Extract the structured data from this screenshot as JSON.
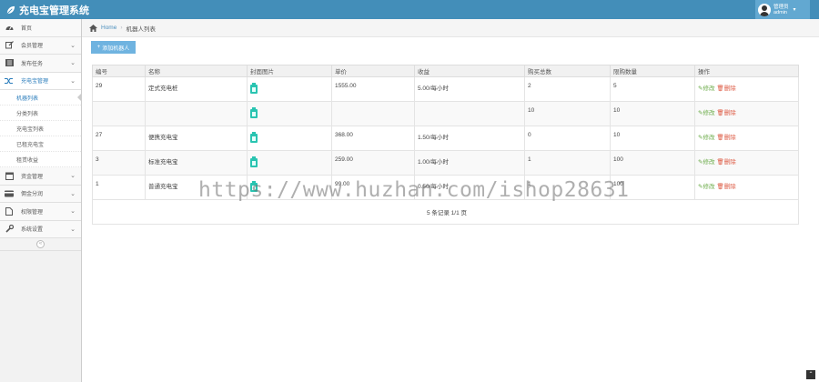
{
  "app": {
    "title": "充电宝管理系统"
  },
  "user": {
    "role": "管理员",
    "name": "admin"
  },
  "sidebar": {
    "items": [
      {
        "label": "首页",
        "icon": "tachometer-icon"
      },
      {
        "label": "会员管理",
        "icon": "edit-icon"
      },
      {
        "label": "发布任务",
        "icon": "list-icon"
      },
      {
        "label": "充电宝管理",
        "icon": "shuffle-icon"
      }
    ],
    "sub_items": [
      "机器列表",
      "分类列表",
      "充电宝列表",
      "已租充电宝",
      "租赁收益"
    ],
    "items_after": [
      {
        "label": "资金管理",
        "icon": "calendar-icon"
      },
      {
        "label": "佣金分润",
        "icon": "card-icon"
      },
      {
        "label": "权限管理",
        "icon": "file-icon"
      },
      {
        "label": "系统设置",
        "icon": "wrench-icon"
      }
    ]
  },
  "breadcrumb": {
    "home": "Home",
    "current": "机器人列表"
  },
  "toolbar": {
    "add_label": "添加机器人"
  },
  "table": {
    "headers": [
      "编号",
      "名称",
      "封面图片",
      "单价",
      "收益",
      "购买总数",
      "限购数量",
      "操作"
    ],
    "rows": [
      {
        "id": "29",
        "name": "定式充电桩",
        "price": "1555.00",
        "income": "5.00/每小时",
        "total": "2",
        "limit": "5"
      },
      {
        "id": "",
        "name": "",
        "price": "",
        "income": "",
        "total": "10",
        "limit": "10"
      },
      {
        "id": "27",
        "name": "便携充电宝",
        "price": "368.00",
        "income": "1.50/每小时",
        "total": "0",
        "limit": "10"
      },
      {
        "id": "3",
        "name": "标准充电宝",
        "price": "259.00",
        "income": "1.00/每小时",
        "total": "1",
        "limit": "100"
      },
      {
        "id": "1",
        "name": "普通充电宝",
        "price": "99.00",
        "income": "0.50/每小时",
        "total": "1",
        "limit": "100"
      }
    ],
    "edit_label": "修改",
    "delete_label": "删除",
    "pager": "5 条记录 1/1 页"
  },
  "watermark": "https://www.huzhan.com/ishop28631"
}
